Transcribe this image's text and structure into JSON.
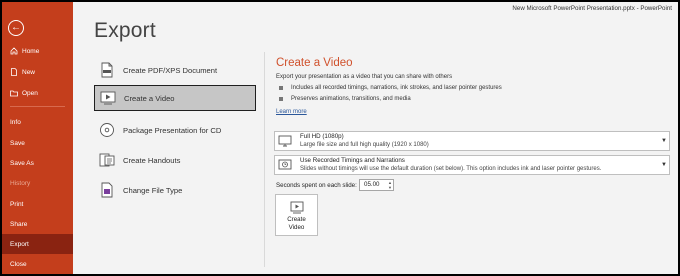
{
  "window": {
    "title": "New Microsoft PowerPoint Presentation.pptx  -  PowerPoint"
  },
  "sidebar": {
    "items": [
      {
        "label": "Home",
        "icon": "home-icon"
      },
      {
        "label": "New",
        "icon": "new-icon"
      },
      {
        "label": "Open",
        "icon": "open-folder-icon"
      },
      {
        "label": "Info"
      },
      {
        "label": "Save"
      },
      {
        "label": "Save As"
      },
      {
        "label": "History",
        "disabled": true
      },
      {
        "label": "Print"
      },
      {
        "label": "Share"
      },
      {
        "label": "Export",
        "active": true
      },
      {
        "label": "Close"
      }
    ]
  },
  "page": {
    "title": "Export"
  },
  "export_options": [
    {
      "label": "Create PDF/XPS Document",
      "icon": "pdf-document-icon"
    },
    {
      "label": "Create a Video",
      "icon": "video-icon",
      "selected": true
    },
    {
      "label": "Package Presentation for CD",
      "icon": "cd-icon"
    },
    {
      "label": "Create Handouts",
      "icon": "handouts-icon"
    },
    {
      "label": "Change File Type",
      "icon": "file-type-icon"
    }
  ],
  "video_panel": {
    "title": "Create a Video",
    "description": "Export your presentation as a video that you can share with others",
    "bullets": [
      "Includes all recorded timings, narrations, ink strokes, and laser pointer gestures",
      "Preserves animations, transitions, and media"
    ],
    "learn_more": "Learn more",
    "quality": {
      "title": "Full HD (1080p)",
      "subtitle": "Large file size and full high quality (1920 x 1080)"
    },
    "timings": {
      "title": "Use Recorded Timings and Narrations",
      "subtitle": "Slides without timings will use the default duration (set below). This option includes ink and laser pointer gestures."
    },
    "seconds_label": "Seconds spent on each slide:",
    "seconds_value": "05.00",
    "create_button": "Create Video"
  },
  "colors": {
    "accent": "#c43e1c",
    "active_nav": "#8a2311",
    "panel_title": "#d0512c",
    "link": "#2b579a"
  }
}
